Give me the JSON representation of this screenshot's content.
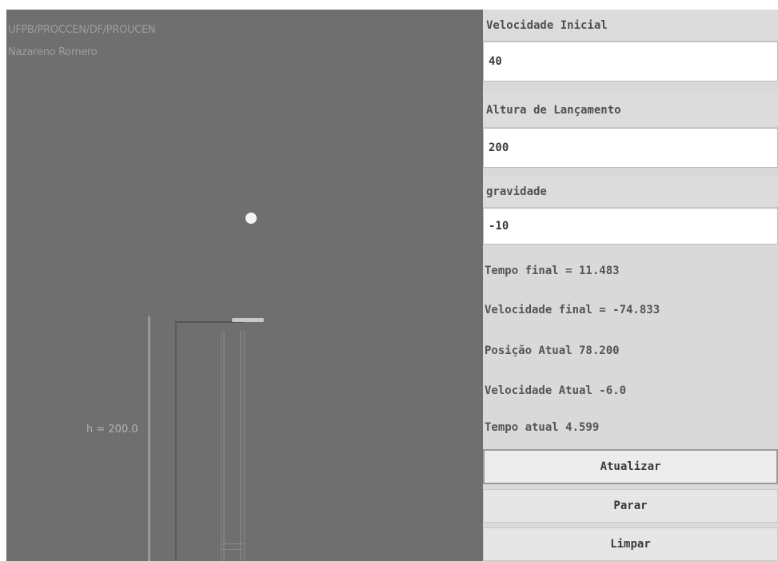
{
  "canvas": {
    "caption_line1": "UFPB/PROCCEN/DF/PROUCEN",
    "caption_line2": "Nazareno Romero",
    "height_label": "h = 200.0"
  },
  "panel": {
    "fields": [
      {
        "label": "Velocidade Inicial",
        "value": "40"
      },
      {
        "label": "Altura de Lançamento",
        "value": "200"
      },
      {
        "label": "gravidade",
        "value": "-10"
      }
    ],
    "status": {
      "tempo_final": "Tempo final = 11.483",
      "velocidade_final": "Velocidade final = -74.833",
      "posicao_atual": "Posição Atual 78.200",
      "velocidade_atual": "Velocidade Atual -6.0",
      "tempo_atual": "Tempo  atual 4.599"
    },
    "buttons": {
      "update": "Atualizar",
      "stop": "Parar",
      "clear": "Limpar"
    }
  }
}
